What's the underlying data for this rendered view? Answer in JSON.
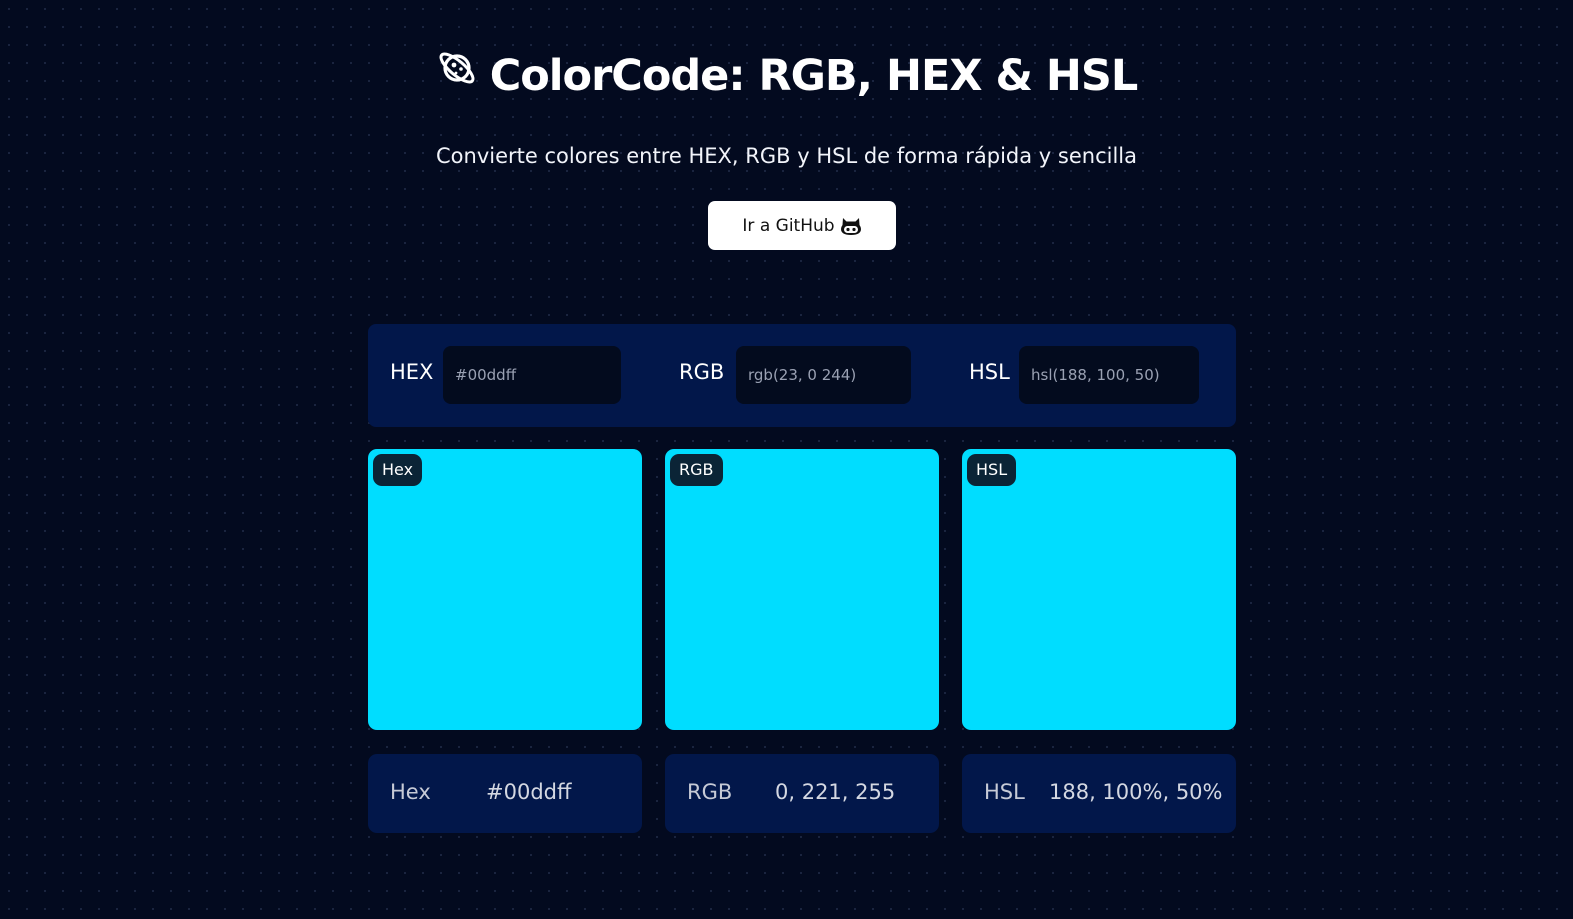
{
  "header": {
    "title": "ColorCode: RGB, HEX & HSL",
    "title_icon": "planet-icon",
    "subtitle": "Convierte colores entre HEX, RGB y HSL de forma rápida y sencilla",
    "github_button_label": "Ir a GitHub",
    "github_button_icon": "github-octocat-icon"
  },
  "inputs": {
    "hex": {
      "label": "HEX",
      "placeholder": "#00ddff",
      "value": ""
    },
    "rgb": {
      "label": "RGB",
      "placeholder": "rgb(23, 0 244)",
      "value": ""
    },
    "hsl": {
      "label": "HSL",
      "placeholder": "hsl(188, 100, 50)",
      "value": ""
    }
  },
  "swatches": [
    {
      "badge": "Hex",
      "color": "#00ddff"
    },
    {
      "badge": "RGB",
      "color": "#00ddff"
    },
    {
      "badge": "HSL",
      "color": "#00ddff"
    }
  ],
  "results": [
    {
      "label": "Hex",
      "value": "#00ddff"
    },
    {
      "label": "RGB",
      "value": "0, 221, 255"
    },
    {
      "label": "HSL",
      "value": "188, 100%, 50%"
    }
  ],
  "colors": {
    "background": "#030a1f",
    "panel": "#02174a",
    "input_background": "#030b1e",
    "swatch": "#00ddff"
  }
}
